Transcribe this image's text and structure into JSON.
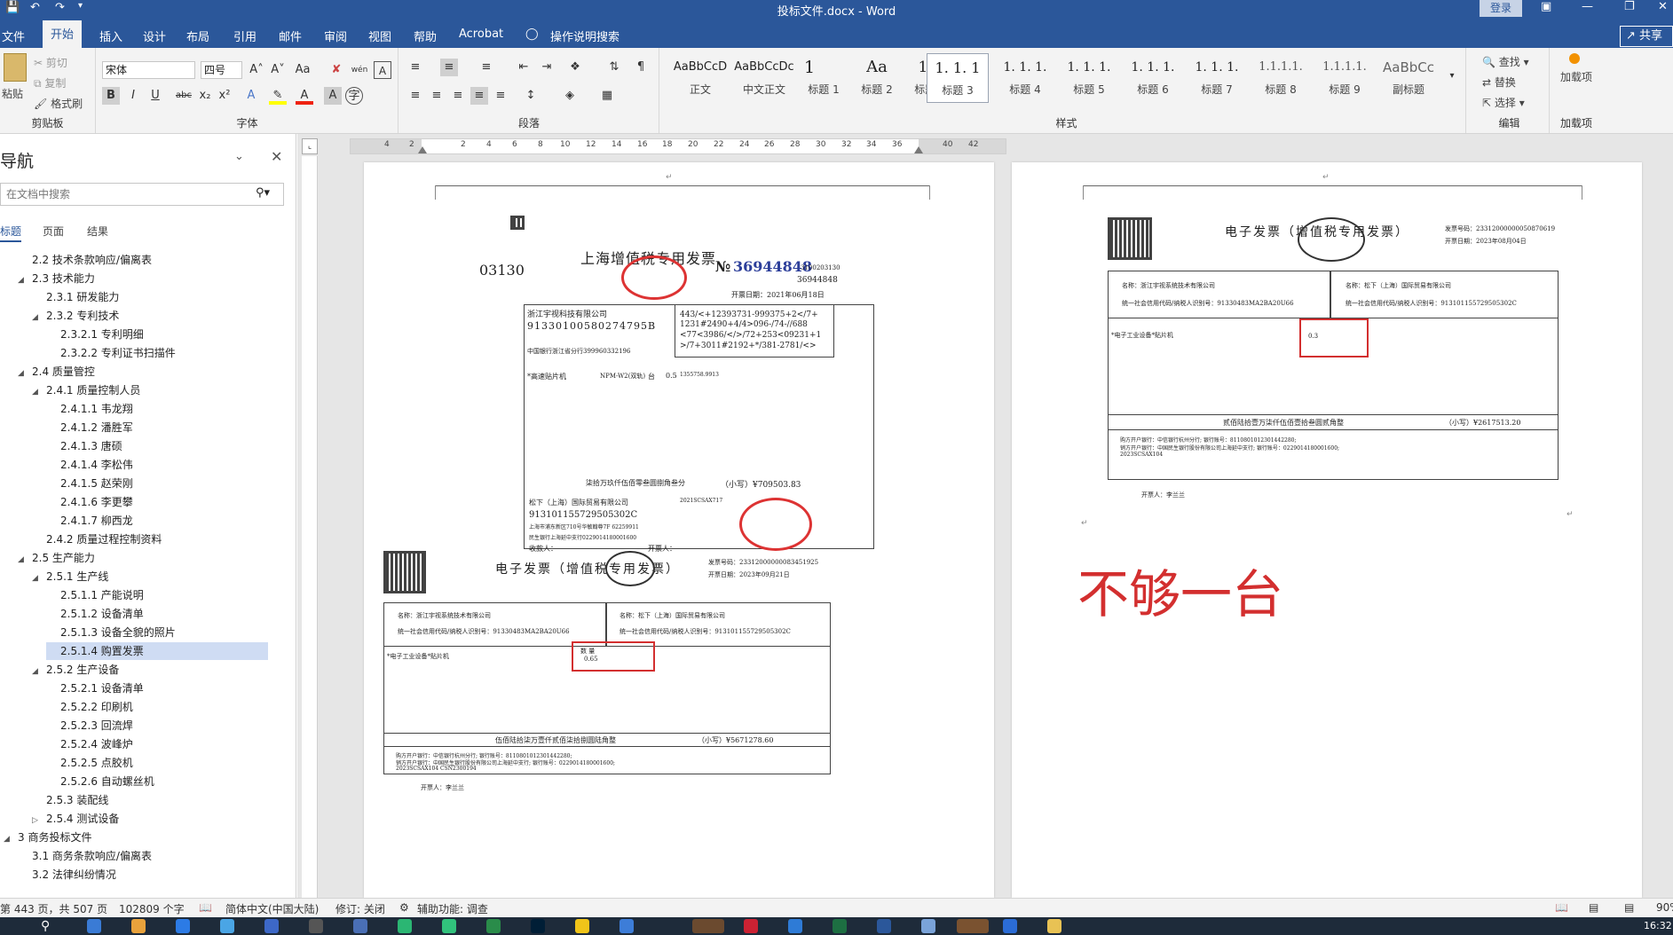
{
  "titlebar": {
    "title": "投标文件.docx  -  Word",
    "login": "登录"
  },
  "menu": {
    "tabs": [
      "文件",
      "开始",
      "插入",
      "设计",
      "布局",
      "引用",
      "邮件",
      "审阅",
      "视图",
      "帮助",
      "Acrobat"
    ],
    "tell_me": "操作说明搜索",
    "share": "共享"
  },
  "ribbon": {
    "clipboard": {
      "paste": "粘贴",
      "cut": "剪切",
      "copy": "复制",
      "format_painter": "格式刷",
      "label": "剪贴板"
    },
    "font": {
      "name": "宋体",
      "size": "四号",
      "label": "字体"
    },
    "paragraph": {
      "label": "段落"
    },
    "styles": {
      "label": "样式",
      "items": [
        {
          "preview": "AaBbCcD",
          "name": "正文"
        },
        {
          "preview": "AaBbCcDc",
          "name": "中文正文"
        },
        {
          "preview": "1",
          "name": "标题 1"
        },
        {
          "preview": "Aa",
          "name": "标题 2"
        },
        {
          "preview": "1.1",
          "name": "标题 3"
        },
        {
          "preview": "1. 1. 1",
          "name": "标题 3"
        },
        {
          "preview": "1. 1. 1.",
          "name": "标题 4"
        },
        {
          "preview": "1. 1. 1.",
          "name": "标题 5"
        },
        {
          "preview": "1. 1. 1.",
          "name": "标题 6"
        },
        {
          "preview": "1. 1. 1.",
          "name": "标题 7"
        },
        {
          "preview": "1.1.1.1.",
          "name": "标题 8"
        },
        {
          "preview": "1.1.1.1.",
          "name": "标题 9"
        },
        {
          "preview": "AaBbCc",
          "name": "副标题"
        }
      ]
    },
    "editing": {
      "find": "查找",
      "replace": "替换",
      "select": "选择",
      "label": "编辑"
    },
    "addins": {
      "addin": "加载项",
      "label": "加载项"
    }
  },
  "nav": {
    "title": "导航",
    "search_placeholder": "在文档中搜索",
    "tabs": [
      "标题",
      "页面",
      "结果"
    ],
    "tree": [
      "2.2 技术条款响应/偏离表",
      "2.3 技术能力",
      "2.3.1 研发能力",
      "2.3.2 专利技术",
      "2.3.2.1 专利明细",
      "2.3.2.2 专利证书扫描件",
      "2.4 质量管控",
      "2.4.1 质量控制人员",
      "2.4.1.1 韦龙翔",
      "2.4.1.2 潘胜军",
      "2.4.1.3 唐硕",
      "2.4.1.4 李松伟",
      "2.4.1.5 赵荣刚",
      "2.4.1.6 李更攀",
      "2.4.1.7 柳西龙",
      "2.4.2 质量过程控制资料",
      "2.5 生产能力",
      "2.5.1 生产线",
      "2.5.1.1 产能说明",
      "2.5.1.2 设备清单",
      "2.5.1.3 设备全貌的照片",
      "2.5.1.4 购置发票",
      "2.5.2 生产设备",
      "2.5.2.1 设备清单",
      "2.5.2.2 印刷机",
      "2.5.2.3 回流焊",
      "2.5.2.4 波峰炉",
      "2.5.2.5 点胶机",
      "2.5.2.6 自动螺丝机",
      "2.5.3 装配线",
      "2.5.4 测试设备",
      "3 商务投标文件",
      "3.1 商务条款响应/偏离表",
      "3.2 法律纠纷情况"
    ]
  },
  "ruler": [
    "4",
    "2",
    "2",
    "4",
    "6",
    "8",
    "10",
    "12",
    "14",
    "16",
    "18",
    "20",
    "22",
    "24",
    "26",
    "28",
    "30",
    "32",
    "34",
    "36",
    "40",
    "42"
  ],
  "doc": {
    "left_page": {
      "inv1": {
        "code": "03130",
        "title": "上海增值税专用发票",
        "no_prefix": "№",
        "no": "36944848",
        "no_small": "3100203130",
        "no_small2": "36944848",
        "date": "开票日期：2021年06月18日",
        "buyer": "浙江宇视科技有限公司",
        "buyer_tax": "91330100580274795B",
        "buyer_bank": "中国银行浙江省分行399960332196",
        "cipher": [
          "443/<+12393731-999375+2</7+",
          "1231#2490+4/4>096-/74-//688",
          "<77<3986/</>/72+253<09231+1",
          ">/7+3011#2192+*/381-2781/<>"
        ],
        "item": "*高速贴片机",
        "model": "NPM-W2(双轨)",
        "unit": "台",
        "qty": "0.5",
        "price": "1355758.9913",
        "total_upper": "柒拾万玖仟伍佰零叁圆捌角叁分",
        "total_small": "（小写）¥709503.83",
        "seller_name": "松下（上海）国际贸易有限公司",
        "seller_tax": "913101155729505302C",
        "seller_addr": "上海市浦东新区710号华敏翰尊7F 62259911",
        "seller_bank": "民生银行上海延中支行0229014180001600",
        "remark": "2021SCSAX717",
        "payee": "收款人：",
        "drawer": "开票人："
      },
      "inv2": {
        "title": "电子发票（增值税专用发票）",
        "num_label": "发票号码：23312000000083451925",
        "date": "开票日期：2023年09月21日",
        "buyer": "名称：浙江宇视系统技术有限公司",
        "buyer_tax": "统一社会信用代码/纳税人识别号：91330483MA2BA20U66",
        "seller": "名称：松下（上海）国际贸易有限公司",
        "seller_tax": "统一社会信用代码/纳税人识别号：913101155729505302C",
        "item": "*电子工业设备*贴片机",
        "qty_label": "数 量",
        "qty": "0.65",
        "total_upper": "伍佰陆拾柒万壹仟贰佰柒拾捌圆陆角整",
        "total_small": "（小写）¥5671278.60",
        "remark1": "购方开户银行：中信银行杭州分行;   银行账号：8110801012301442280;",
        "remark2": "销方开户银行：中国民生银行股份有限公司上海延中支行;   银行账号：0229014180001600;",
        "remark3": "2023SCSAX104   CSN2300194",
        "drawer": "开票人：李兰兰"
      }
    },
    "right_page": {
      "inv3": {
        "title": "电子发票（增值税专用发票）",
        "num_label": "发票号码：23312000000050870619",
        "date": "开票日期：2023年08月04日",
        "buyer": "名称：浙江宇视系统技术有限公司",
        "buyer_tax": "统一社会信用代码/纳税人识别号：91330483MA2BA20U66",
        "seller": "名称：松下（上海）国际贸易有限公司",
        "seller_tax": "统一社会信用代码/纳税人识别号：913101155729505302C",
        "item": "*电子工业设备*贴片机",
        "qty": "0.3",
        "total_upper": "贰佰陆拾壹万柒仟伍佰壹拾叁圆贰角整",
        "total_small": "（小写）¥2617513.20",
        "remark1": "购方开户银行：中信银行杭州分行;   银行账号：8110801012301442280;",
        "remark2": "销方开户银行：中国民生银行股份有限公司上海延中支行;   银行账号：0229014180001600;",
        "remark3": "2023SCSAX104",
        "drawer": "开票人：李兰兰"
      },
      "annotation": "不够一台"
    }
  },
  "status": {
    "page": "第 443 页，共 507 页",
    "words": "102809 个字",
    "lang": "简体中文(中国大陆)",
    "track": "修订: 关闭",
    "accessibility": "辅助功能: 调查",
    "zoom": "90%"
  },
  "taskbar": {
    "time": "16:32"
  },
  "colors": {
    "accent": "#2b579a",
    "annotation": "#d32f2f",
    "highlight": "#cfdcf3"
  }
}
